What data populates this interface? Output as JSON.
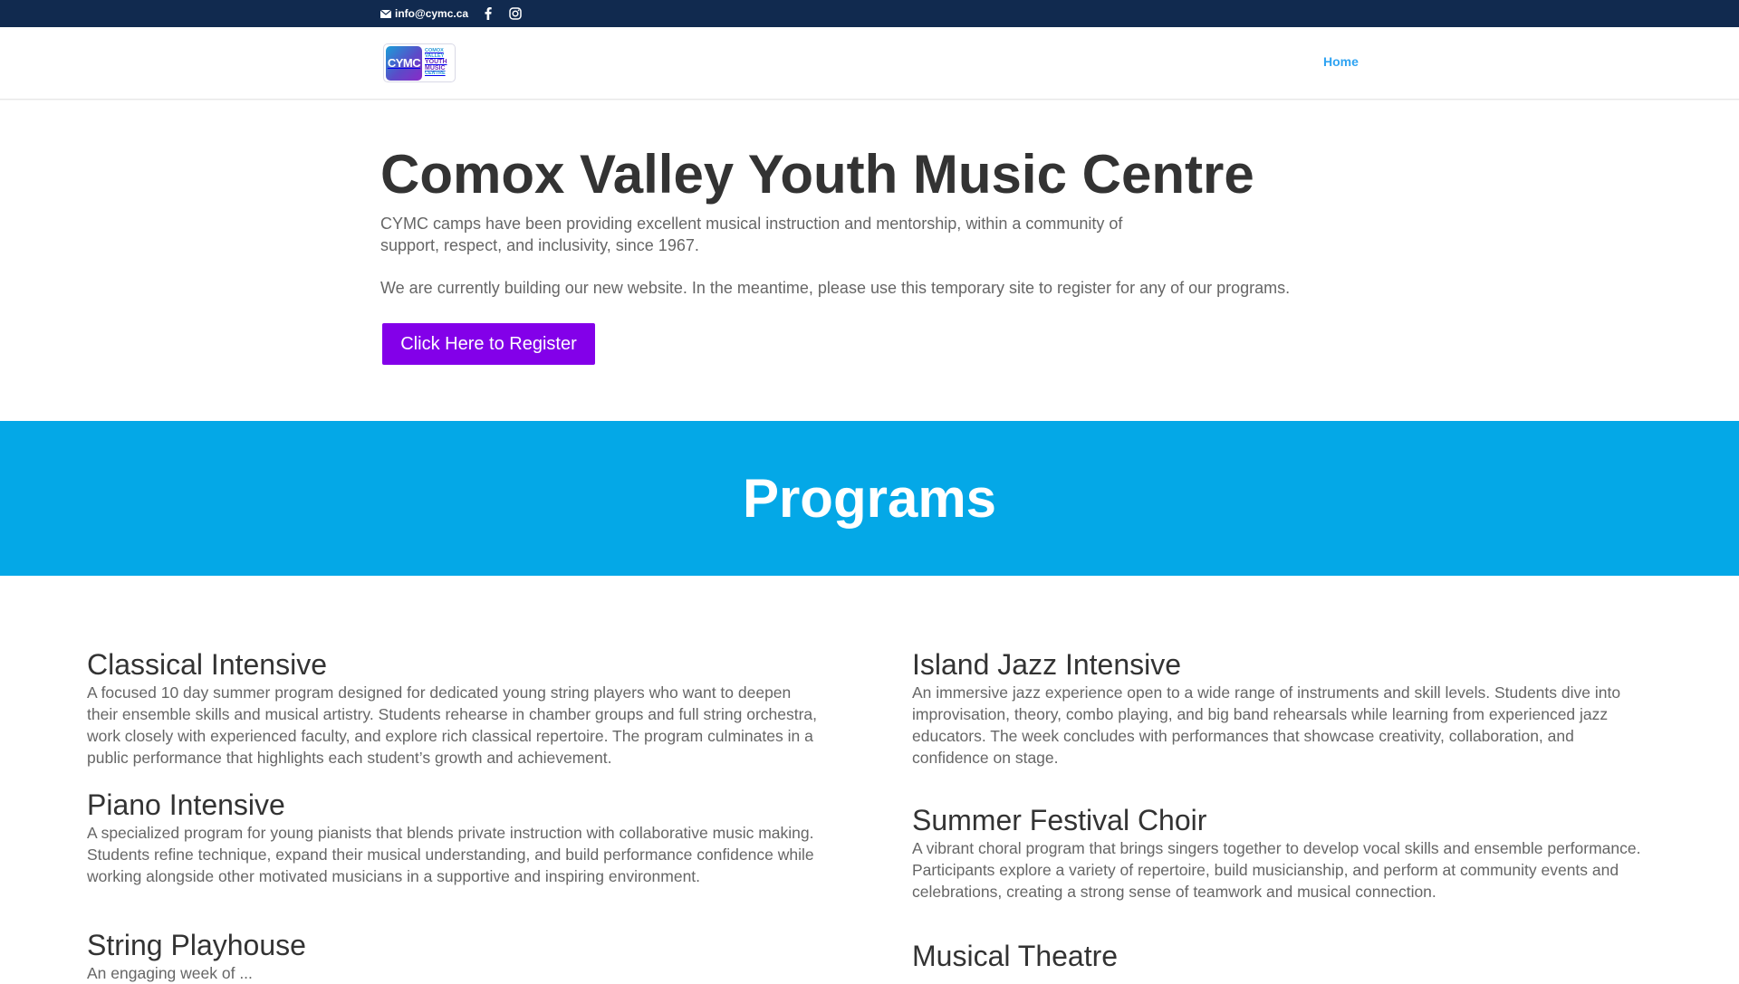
{
  "topbar": {
    "email": "info@cymc.ca",
    "icons": [
      "envelope-icon",
      "facebook-icon",
      "instagram-icon"
    ]
  },
  "header": {
    "logo": {
      "mark": "CYMC",
      "line1": "COMOX",
      "line2": "VALLEY",
      "line3": "YOUTH",
      "line4": "MUSIC",
      "line5": "CENTRE"
    },
    "nav": {
      "home": "Home"
    }
  },
  "hero": {
    "title": "Comox Valley Youth Music Centre",
    "intro": "CYMC camps have been providing excellent musical instruction and mentorship, within a community of support, respect, and inclusivity, since 1967.",
    "notice": "We are currently building our new website. In the meantime, please use this temporary site to register for any of our programs.",
    "register_label": "Click Here to Register"
  },
  "programs": {
    "heading": "Programs",
    "left": [
      {
        "title": "Classical Intensive",
        "desc": "A focused 10 day summer program designed for dedicated young string players who want to deepen their ensemble skills and musical artistry. Students rehearse in chamber groups and full string orchestra, work closely with experienced faculty, and explore rich classical repertoire. The program culminates in a public performance that highlights each student’s growth and achievement."
      },
      {
        "title": "Piano Intensive",
        "desc": "A specialized program for young pianists that blends private instruction with collaborative music making. Students refine technique, expand their musical understanding, and build performance confidence while working alongside other motivated musicians in a supportive and inspiring environment."
      },
      {
        "title": "String Playhouse",
        "desc": "An engaging week of ..."
      }
    ],
    "right": [
      {
        "title": "Island Jazz Intensive",
        "desc": "An immersive jazz experience open to a wide range of instruments and skill levels. Students dive into improvisation, theory, combo playing, and big band rehearsals while learning from experienced jazz educators. The week concludes with performances that showcase creativity, collaboration, and confidence on stage."
      },
      {
        "title": "Summer Festival Choir",
        "desc": "A vibrant choral program that brings singers together to develop vocal skills and ensemble performance. Participants explore a variety of repertoire, build musicianship, and perform at community events and celebrations, creating a strong sense of teamwork and musical connection."
      },
      {
        "title": "Musical Theatre",
        "desc": ""
      }
    ]
  },
  "colors": {
    "topbar": "#112a4f",
    "accent_link": "#2ea3f2",
    "register_button": "#8300e9",
    "programs_band": "#04a8e7"
  }
}
